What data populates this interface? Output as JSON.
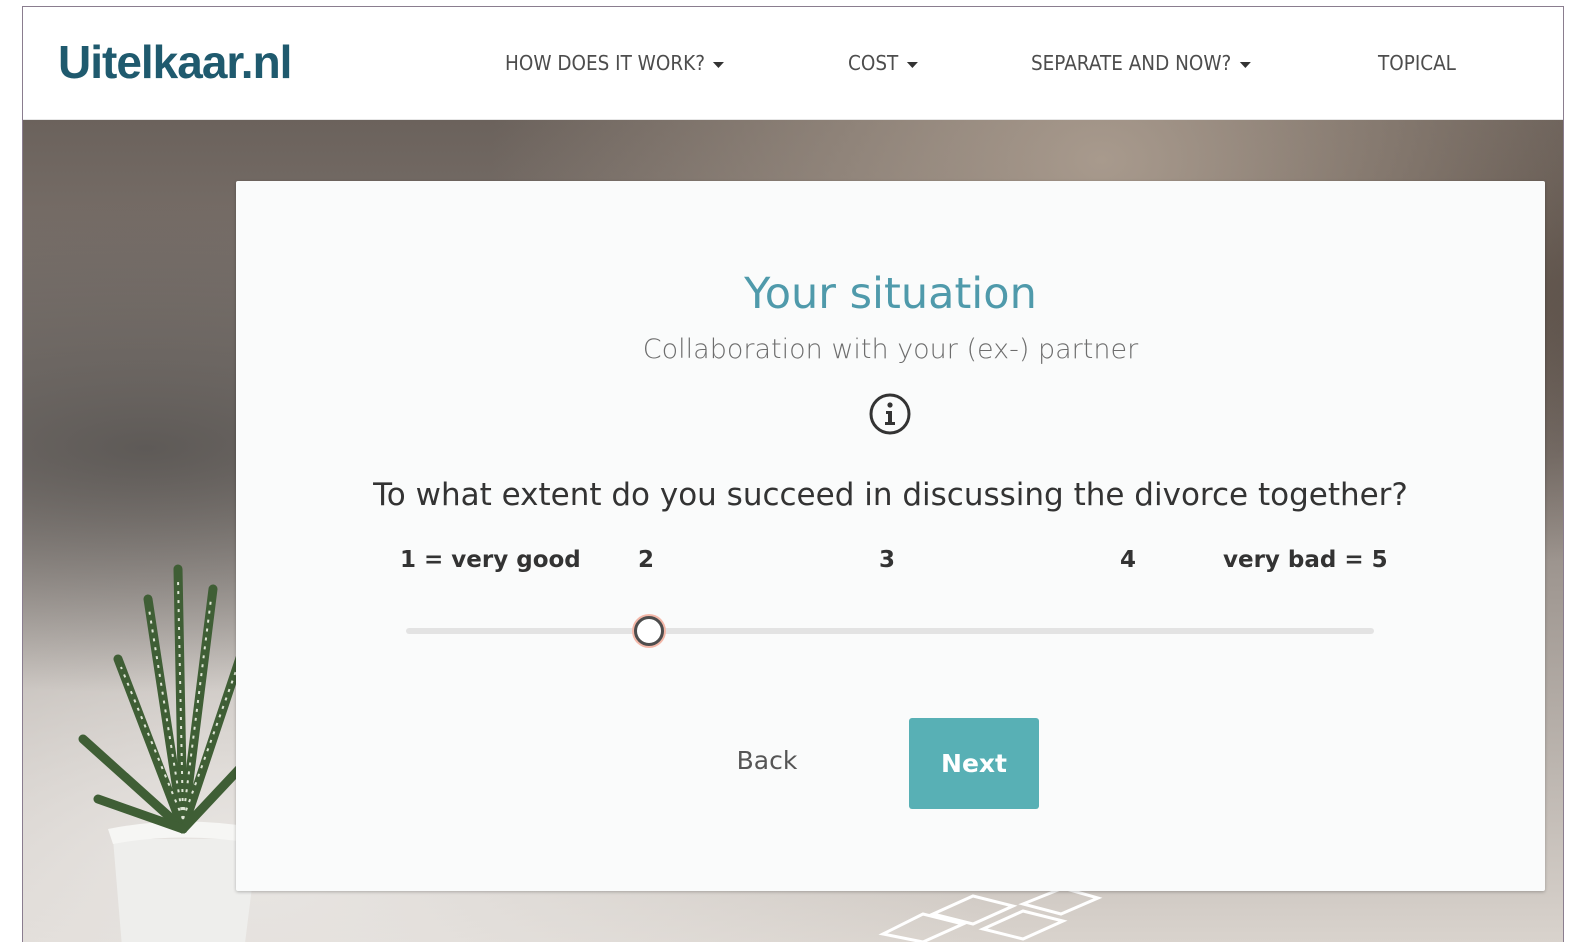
{
  "brand": {
    "logo_text": "Uitelkaar.nl",
    "color": "#1f5a6e"
  },
  "nav": {
    "items": [
      {
        "label": "HOW DOES IT WORK?",
        "has_dropdown": true
      },
      {
        "label": "COST",
        "has_dropdown": true
      },
      {
        "label": "SEPARATE AND NOW?",
        "has_dropdown": true
      },
      {
        "label": "TOPICAL",
        "has_dropdown": false
      }
    ]
  },
  "card": {
    "title": "Your situation",
    "subtitle": "Collaboration with your (ex-) partner",
    "info_icon": "info-circle-icon",
    "question": "To what extent do you succeed in discussing the divorce together?",
    "scale_labels": [
      "1 = very good",
      "2",
      "3",
      "4",
      "very bad = 5"
    ],
    "slider": {
      "min": 1,
      "max": 5,
      "value": 2
    },
    "back_label": "Back",
    "next_label": "Next",
    "accent_color": "#58b0b5",
    "title_color": "#4f9aab"
  }
}
